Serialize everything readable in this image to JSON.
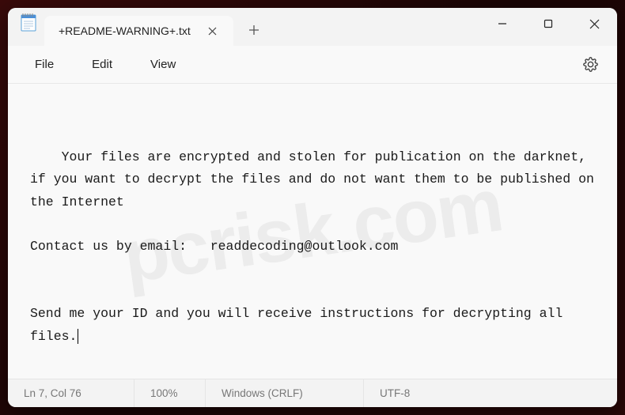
{
  "tab": {
    "title": "+README-WARNING+.txt"
  },
  "menu": {
    "file": "File",
    "edit": "Edit",
    "view": "View"
  },
  "document": {
    "text": "Your files are encrypted and stolen for publication on the darknet,\nif you want to decrypt the files and do not want them to be published on the Internet\n\nContact us by email:   readdecoding@outlook.com\n\n\nSend me your ID and you will receive instructions for decrypting all files."
  },
  "status": {
    "position": "Ln 7, Col 76",
    "zoom": "100%",
    "eol": "Windows (CRLF)",
    "encoding": "UTF-8"
  },
  "watermark": "pcrisk.com"
}
